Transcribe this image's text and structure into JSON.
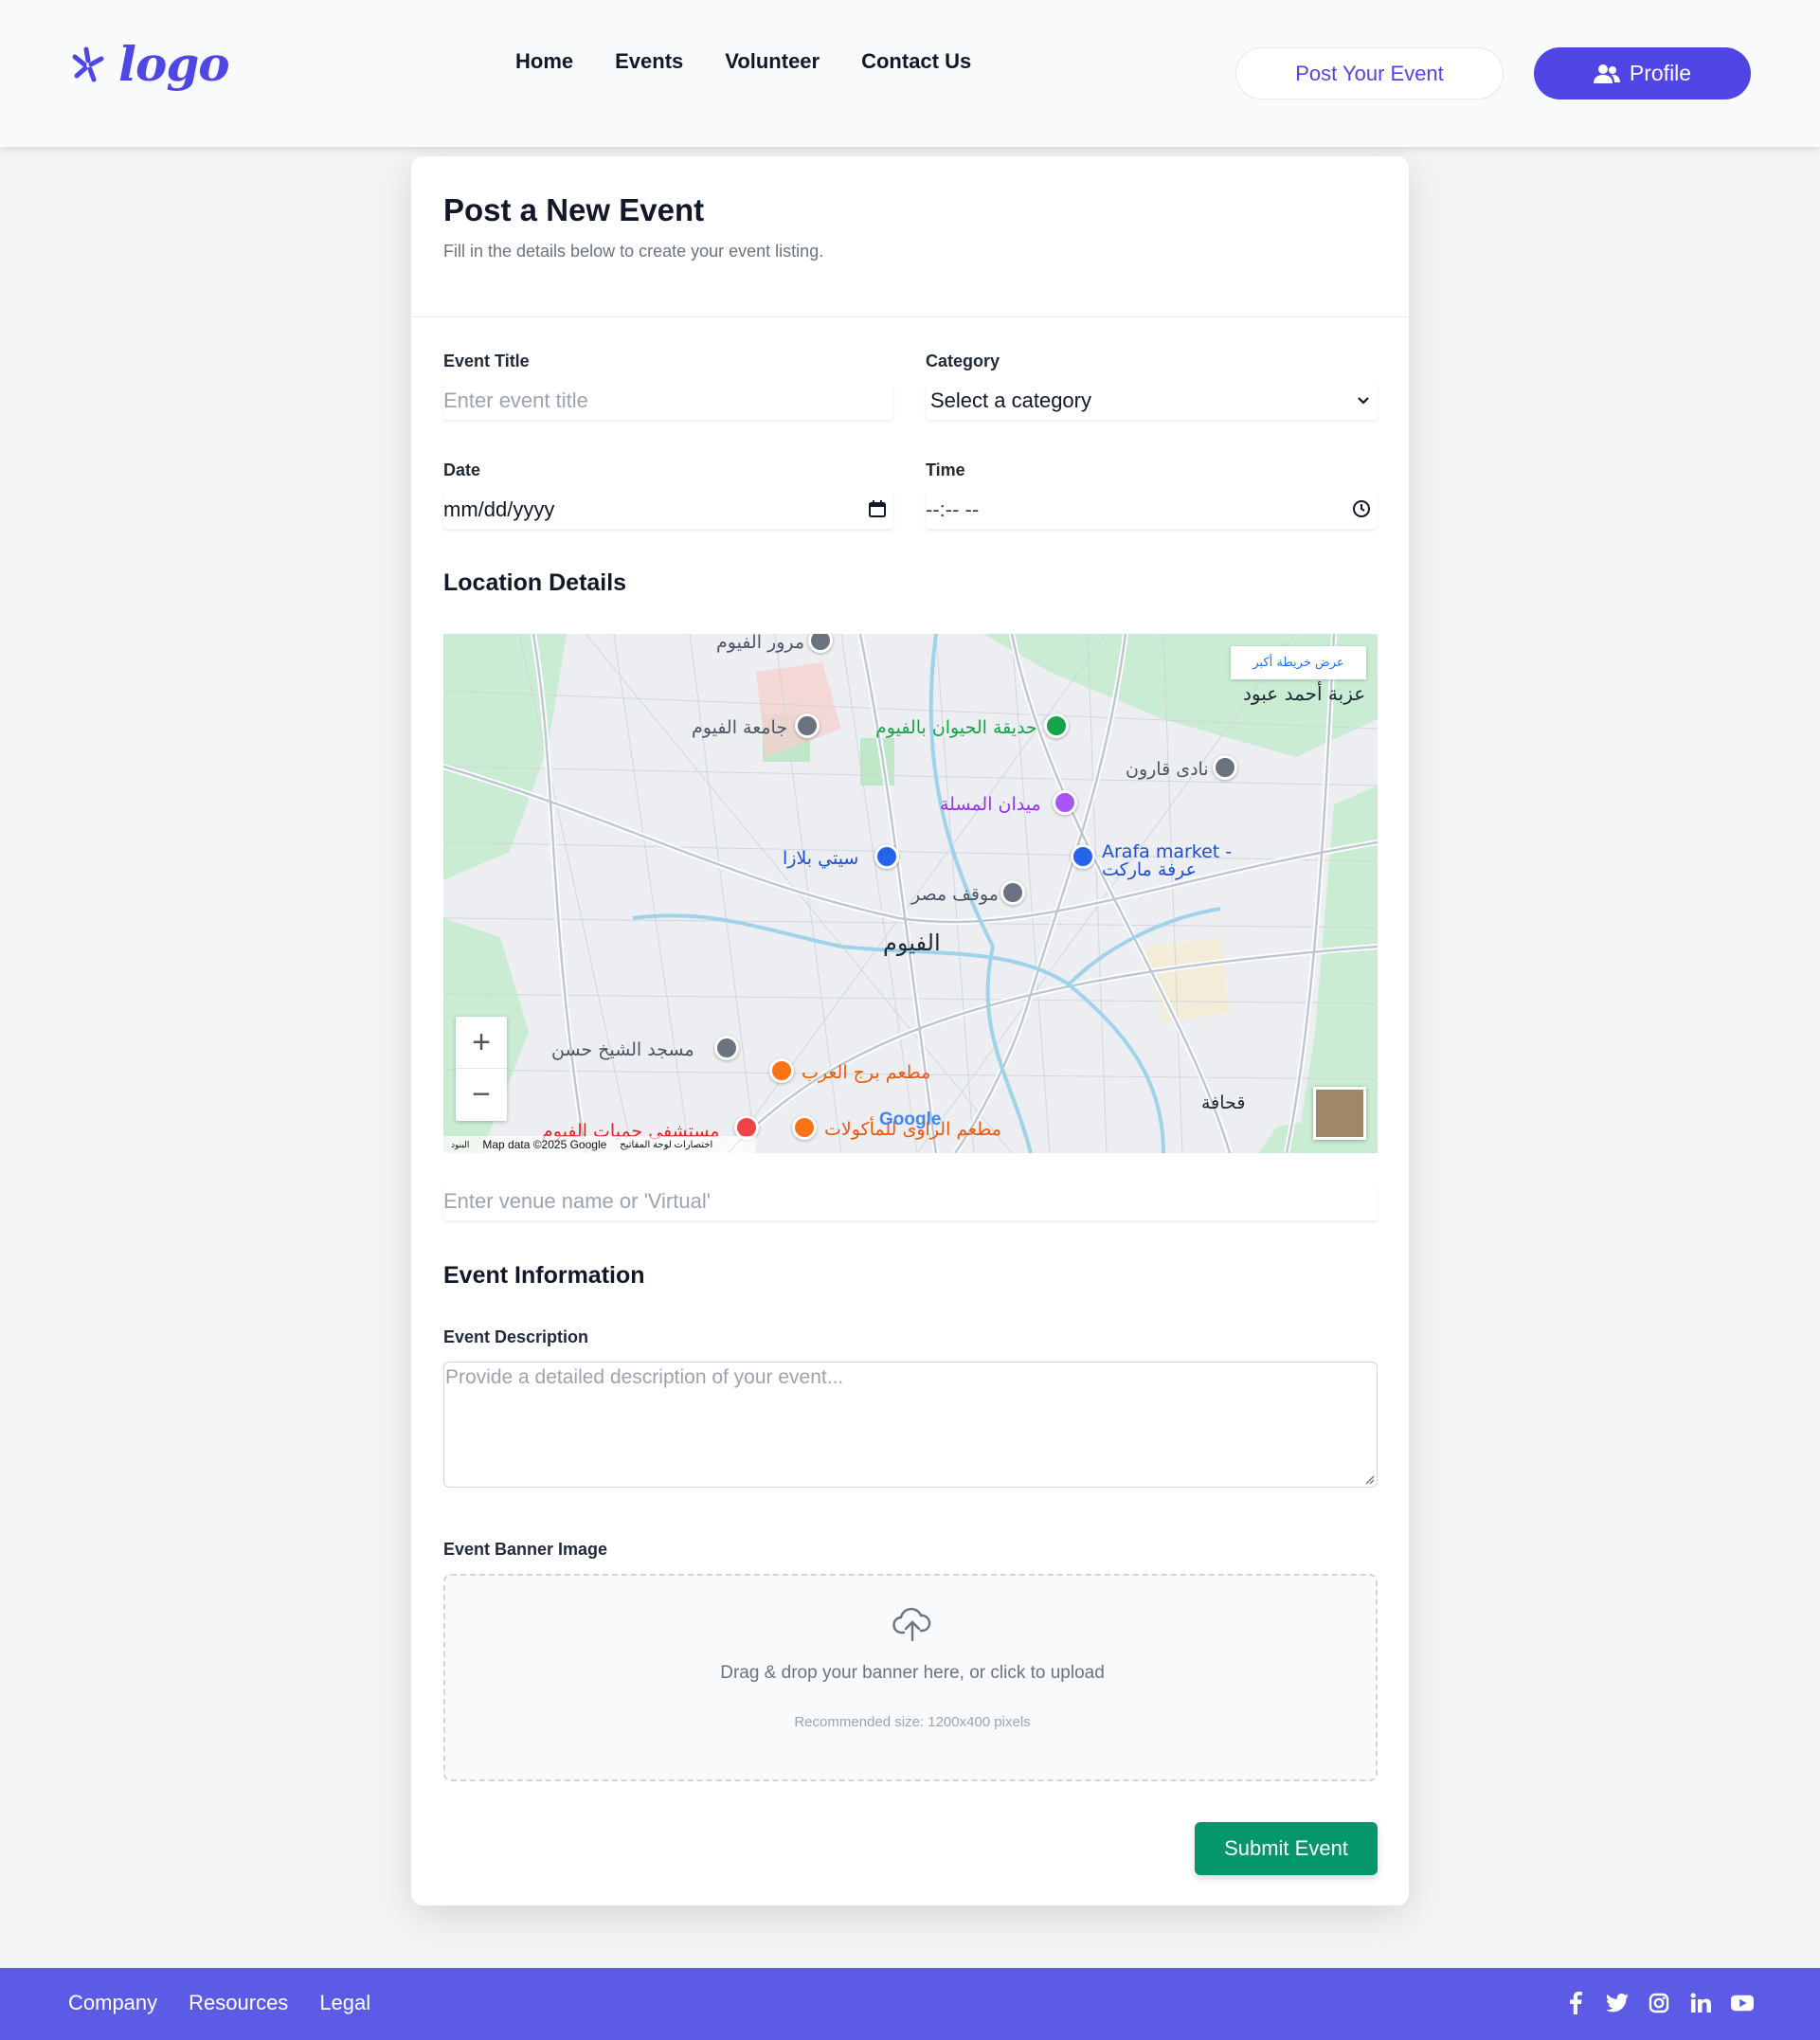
{
  "header": {
    "logo_text": "logo",
    "nav": [
      "Home",
      "Events",
      "Volunteer",
      "Contact Us"
    ],
    "post_button": "Post Your Event",
    "profile_button": "Profile"
  },
  "form": {
    "title": "Post a New Event",
    "subtitle": "Fill in the details below to create your event listing.",
    "event_title_label": "Event Title",
    "event_title_placeholder": "Enter event title",
    "category_label": "Category",
    "category_value": "Select a category",
    "date_label": "Date",
    "date_value": "mm/dd/yyyy",
    "time_label": "Time",
    "time_value": "--:-- --",
    "location_heading": "Location Details",
    "venue_placeholder": "Enter venue name or 'Virtual'",
    "info_heading": "Event Information",
    "description_label": "Event Description",
    "description_placeholder": "Provide a detailed description of your event...",
    "banner_label": "Event Banner Image",
    "banner_drop_text": "Drag & drop your banner here, or click to upload",
    "banner_hint": "Recommended size: 1200x400 pixels",
    "submit_button": "Submit Event"
  },
  "map": {
    "view_larger": "عرض خريطة أكبر",
    "city": "الفيوم",
    "places": {
      "muroor": "مرور الفيوم",
      "university": "جامعة الفيوم",
      "zoo": "حديقة الحيوان بالفيوم",
      "ezbet": "عزبة أحمد عبود",
      "nadi": "نادى قارون",
      "midan": "ميدان المسلة",
      "city_plaza": "سيتي بلازا",
      "arafa_en": "Arafa market -",
      "arafa_ar": "عرفة ماركت",
      "mawqif": "موقف مصر",
      "masjid": "مسجد الشيخ حسن",
      "burg": "مطعم برج العرب",
      "rawy": "مطعم الراوى للمأكولات",
      "hospital": "مستشفى حميات الفيوم",
      "qahafa": "قحافة"
    },
    "zoom_in": "+",
    "zoom_out": "−",
    "attribution": "Map data ©2025 Google",
    "shortcuts": "اختصارات لوحة المفاتيح",
    "terms": "البنود",
    "google": "Google"
  },
  "footer": {
    "links": [
      "Company",
      "Resources",
      "Legal"
    ],
    "social": [
      "facebook-icon",
      "twitter-icon",
      "instagram-icon",
      "linkedin-icon",
      "youtube-icon"
    ]
  },
  "colors": {
    "brand": "#4f46e5",
    "footer": "#5b5be6",
    "submit": "#059669"
  }
}
